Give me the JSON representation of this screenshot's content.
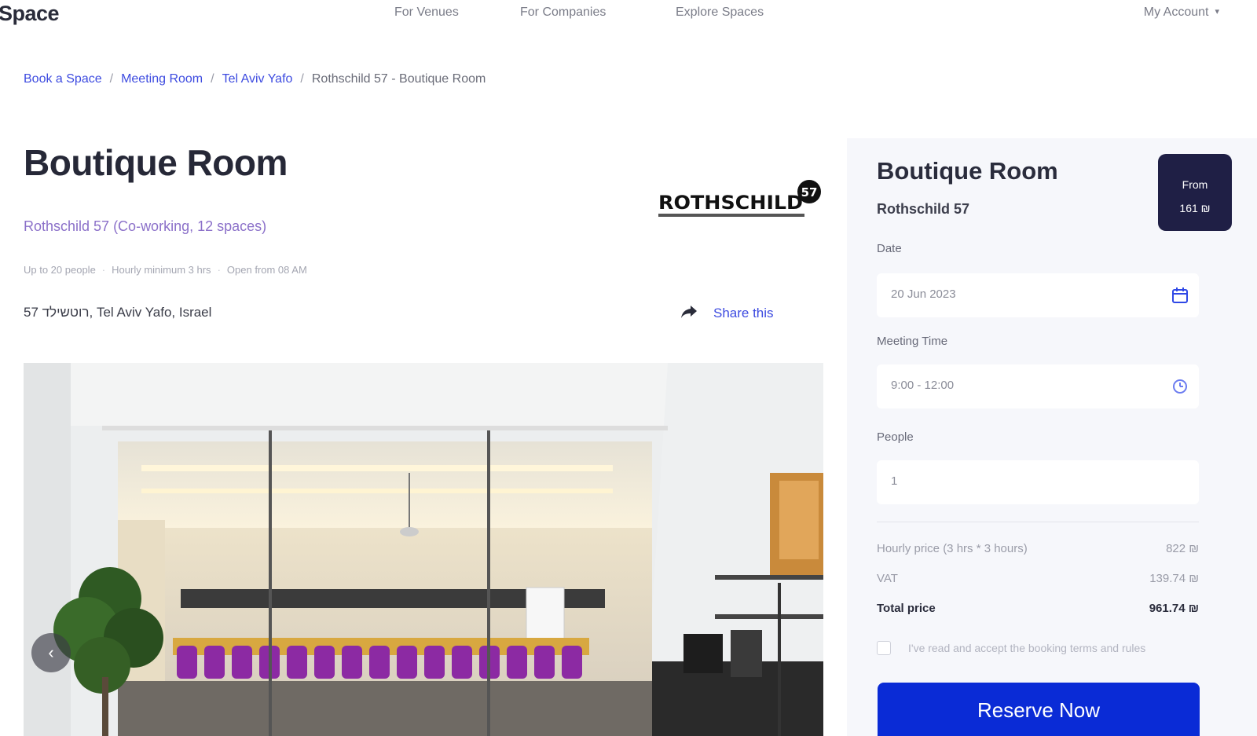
{
  "brand": {
    "logo_text": "Space"
  },
  "nav": {
    "items": [
      {
        "label": "For Venues"
      },
      {
        "label": "For Companies"
      },
      {
        "label": "Explore Spaces"
      }
    ],
    "account_label": "My Account",
    "account_chevron": "▾"
  },
  "breadcrumb": {
    "items": [
      {
        "label": "Book a Space"
      },
      {
        "label": "Meeting Room"
      },
      {
        "label": "Tel Aviv Yafo"
      }
    ],
    "separator": "/",
    "current": "Rothschild 57 - Boutique Room"
  },
  "listing": {
    "title": "Boutique Room",
    "venue_link": "Rothschild 57 (Co-working, 12 spaces)",
    "meta": [
      "Up to 20 people",
      "Hourly minimum 3 hrs",
      "Open from 08 AM"
    ],
    "address": "57 רוטשילד, Tel Aviv Yafo, Israel",
    "share_label": "Share this",
    "venue_logo_text": "ROTHSCHILD",
    "venue_logo_number": "57"
  },
  "photo": {
    "prev_arrow": "‹"
  },
  "booking": {
    "title": "Boutique Room",
    "venue": "Rothschild 57",
    "price_badge": {
      "line1": "From",
      "line2": "161 ₪"
    },
    "date_label": "Date",
    "date_value": "20 Jun 2023",
    "time_label": "Meeting Time",
    "time_value": "9:00 - 12:00",
    "people_label": "People",
    "people_value": "1",
    "hourly_label": "Hourly price (3 hrs * 3 hours)",
    "hourly_value": "822 ₪",
    "vat_label": "VAT",
    "vat_value": "139.74 ₪",
    "total_label": "Total price",
    "total_value": "961.74 ₪",
    "terms_text": "I've read and accept the booking terms and rules",
    "reserve_label": "Reserve Now"
  },
  "colors": {
    "accent_blue": "#0a2bd6",
    "link_blue": "#3d4be0",
    "venue_purple": "#8b70c9",
    "badge_navy": "#1f1f45",
    "card_bg": "#f6f7fb"
  },
  "icons": {
    "calendar": "calendar-icon",
    "clock": "clock-icon",
    "share": "share-icon",
    "chevron": "chevron-down-icon",
    "arrow": "arrow-left-icon"
  }
}
